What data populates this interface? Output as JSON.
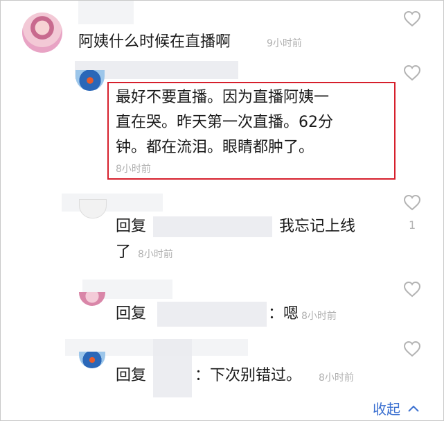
{
  "comments": [
    {
      "text": "阿姨什么时候在直播啊",
      "time": "9小时前"
    },
    {
      "line1": "最好不要直播。因为直播阿姨一",
      "line2": "直在哭。昨天第一次直播。62分",
      "line3": "钟。都在流泪。眼睛都肿了。",
      "time": "8小时前"
    },
    {
      "prefix": "回复",
      "text": "我忘记上线",
      "text_cont": "了",
      "time": "8小时前",
      "like_count": "1"
    },
    {
      "prefix": "回复",
      "text": "：嗯",
      "time": "8小时前"
    },
    {
      "prefix": "回复",
      "text": "：下次别错过。",
      "time": "8小时前"
    }
  ],
  "footer": {
    "collapse_label": "收起"
  },
  "colors": {
    "accent": "#3a6fd0",
    "highlight_border": "#d61f2c",
    "timestamp": "#b0b0b0"
  },
  "icons": [
    "heart-outline-icon",
    "chevron-up-icon"
  ]
}
